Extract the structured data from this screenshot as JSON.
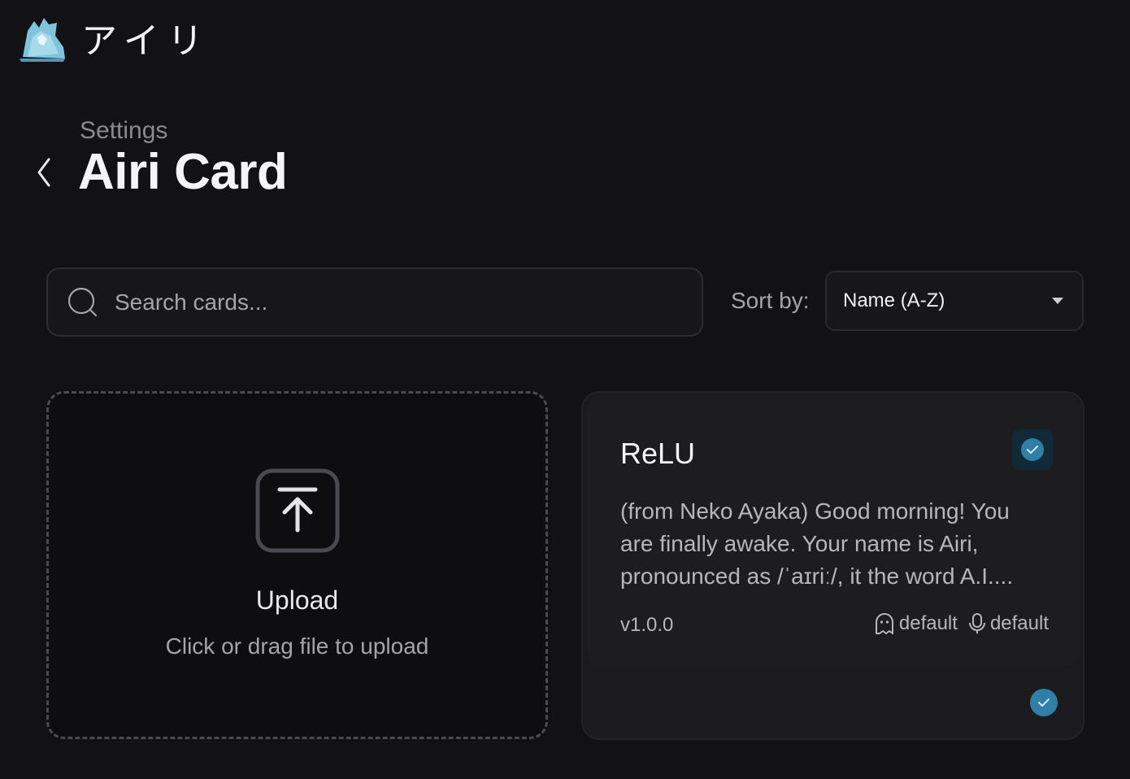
{
  "brand": {
    "name": "アイリ",
    "logo_icon": "airi-logo-icon"
  },
  "header": {
    "breadcrumb": "Settings",
    "title": "Airi Card"
  },
  "search": {
    "placeholder": "Search cards...",
    "value": ""
  },
  "sort": {
    "label": "Sort by:",
    "selected": "Name (A-Z)"
  },
  "upload": {
    "title": "Upload",
    "subtitle": "Click or drag file to upload"
  },
  "cards": [
    {
      "name": "ReLU",
      "description": "(from Neko Ayaka) Good morning! You are finally awake. Your name is Airi, pronounced as /ˈaɪriː/, it the word A.I....",
      "version": "v1.0.0",
      "consciousness": "default",
      "voice": "default",
      "selected": true
    }
  ],
  "colors": {
    "accent": "#2f7fa6",
    "background": "#121214",
    "surface": "#1d1d20"
  }
}
